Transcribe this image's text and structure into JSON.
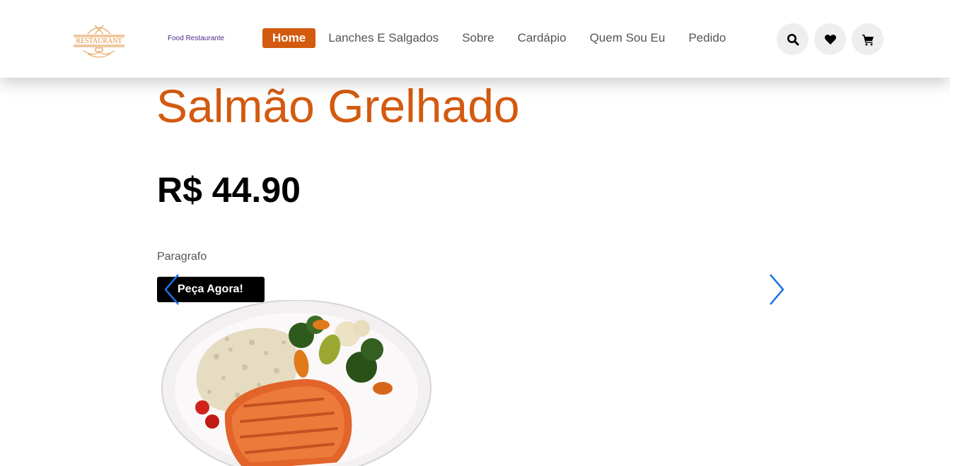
{
  "header": {
    "logo_text": "RESTAURANT",
    "brand_tag": "Food Restaurante",
    "nav": [
      {
        "label": "Home",
        "active": true
      },
      {
        "label": "Lanches E Salgados",
        "active": false
      },
      {
        "label": "Sobre",
        "active": false
      },
      {
        "label": "Cardápio",
        "active": false
      },
      {
        "label": "Quem Sou Eu",
        "active": false
      },
      {
        "label": "Pedido",
        "active": false
      }
    ],
    "icons": [
      "search-icon",
      "heart-icon",
      "cart-icon"
    ]
  },
  "slide": {
    "title": "Salmão Grelhado",
    "price": "R$ 44.90",
    "paragraph": "Paragrafo",
    "cta_label": "Peça Agora!"
  },
  "colors": {
    "accent": "#d35a0f",
    "arrow": "#1a73e8",
    "button_bg": "#000000"
  }
}
